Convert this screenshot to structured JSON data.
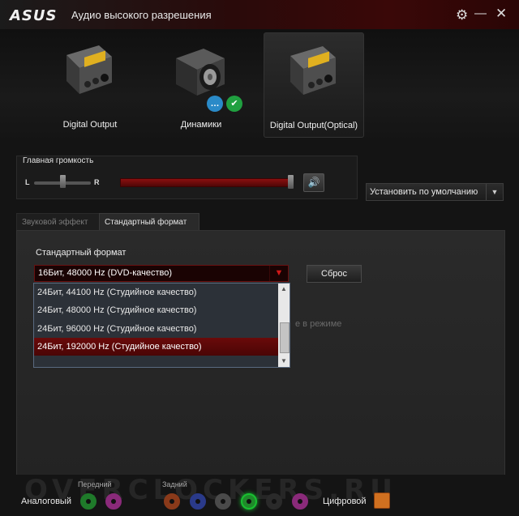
{
  "window": {
    "logo": "ASUS",
    "title": "Аудио высокого разрешения"
  },
  "icons": {
    "settings": "gear-icon",
    "minimize": "minimize-icon",
    "close": "close-icon",
    "speaker_volume": "speaker-icon",
    "dropdown": "chevron-down-icon"
  },
  "devices": [
    {
      "label": "Digital Output",
      "selected": false
    },
    {
      "label": "Динамики",
      "selected": false
    },
    {
      "label": "Digital Output(Optical)",
      "selected": true
    }
  ],
  "volume": {
    "title": "Главная громкость",
    "left": "L",
    "right": "R",
    "level": 1.0,
    "balance": 0.5
  },
  "default_button": "Установить по умолчанию",
  "tabs": [
    {
      "label": "Звуковой эффект",
      "active": false
    },
    {
      "label": "Стандартный формат",
      "active": true
    }
  ],
  "format": {
    "label": "Стандартный формат",
    "selected": "16Бит, 48000 Hz (DVD-качество)",
    "reset": "Сброс",
    "hidden_text": "е в режиме",
    "options": [
      "24Бит, 44100 Hz (Студийное качество)",
      "24Бит, 48000 Hz (Студийное качество)",
      "24Бит, 96000 Hz (Студийное качество)",
      "24Бит, 192000 Hz (Студийное качество)"
    ],
    "highlighted_index": 3
  },
  "jacks": {
    "analog_label": "Аналоговый",
    "front_label": "Передний",
    "back_label": "Задний",
    "digital_label": "Цифровой",
    "front_colors": [
      "#1f7a2a",
      "#8a2a7a"
    ],
    "back_colors": [
      "#8a3a1a",
      "#2a3a8a",
      "#4a4a4a",
      "#1f8a2a",
      "#2a2a2a",
      "#8a2a7a"
    ],
    "active_color": "#18c030"
  },
  "colors": {
    "accent": "#8a1010",
    "selection": "#6a0a0a"
  },
  "watermark": "OVERCLOCKERS.RU"
}
